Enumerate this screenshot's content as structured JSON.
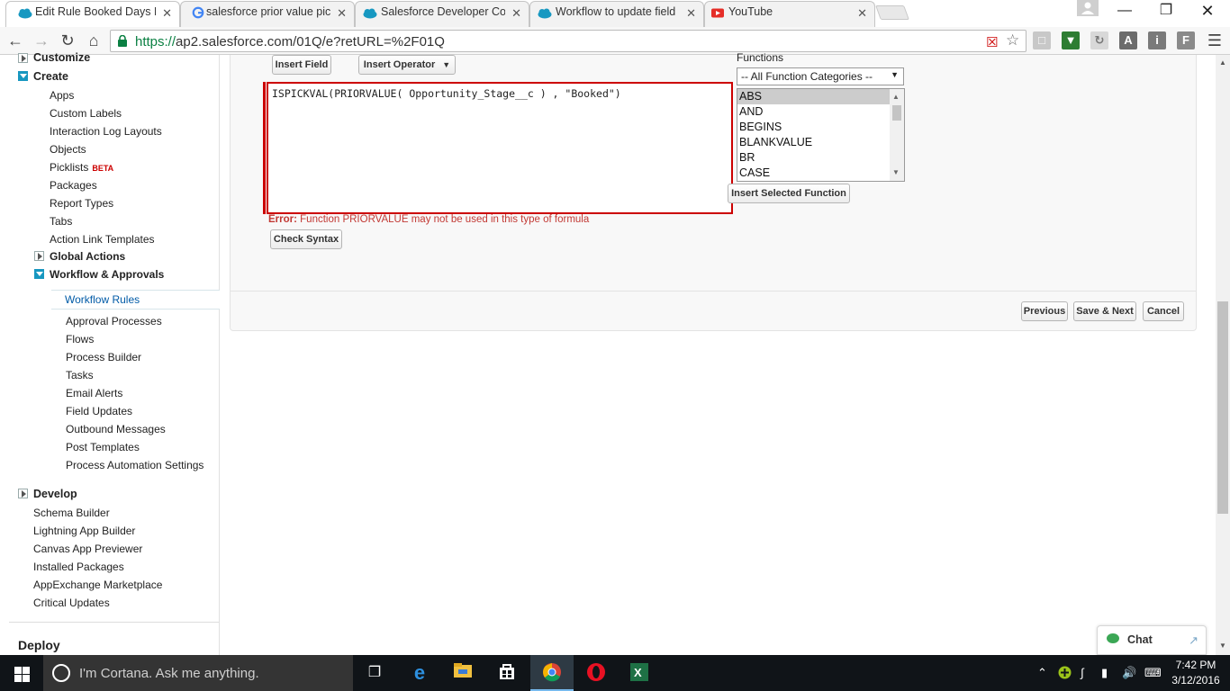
{
  "browser": {
    "tabs": [
      {
        "title": "Edit Rule Booked Days Ru",
        "favicon": "salesforce-cloud-icon",
        "active": true
      },
      {
        "title": "salesforce prior value pick",
        "favicon": "google-g-icon",
        "active": false
      },
      {
        "title": "Salesforce Developer Com",
        "favicon": "salesforce-cloud-icon",
        "active": false
      },
      {
        "title": "Workflow to update field",
        "favicon": "salesforce-cloud-icon",
        "active": false
      },
      {
        "title": "YouTube",
        "favicon": "youtube-icon",
        "active": false
      }
    ],
    "close_glyph": "✕",
    "url_scheme": "https://",
    "url_rest": "ap2.salesforce.com/01Q/e?retURL=%2F01Q"
  },
  "sidebar": {
    "customize": "Customize",
    "create": "Create",
    "create_items": [
      "Apps",
      "Custom Labels",
      "Interaction Log Layouts",
      "Objects",
      "Picklists",
      "Packages",
      "Report Types",
      "Tabs",
      "Action Link Templates"
    ],
    "beta": "BETA",
    "global_actions": "Global Actions",
    "workflow": "Workflow & Approvals",
    "workflow_selected": "Workflow Rules",
    "workflow_items": [
      "Approval Processes",
      "Flows",
      "Process Builder",
      "Tasks",
      "Email Alerts",
      "Field Updates",
      "Outbound Messages",
      "Post Templates",
      "Process Automation Settings"
    ],
    "develop": "Develop",
    "develop_items": [
      "Schema Builder",
      "Lightning App Builder",
      "Canvas App Previewer",
      "Installed Packages",
      "AppExchange Marketplace",
      "Critical Updates"
    ],
    "deploy": "Deploy"
  },
  "editor": {
    "insert_field": "Insert Field",
    "insert_operator": "Insert Operator",
    "formula": "ISPICKVAL(PRIORVALUE( Opportunity_Stage__c ) , \"Booked\")",
    "error_label": "Error:",
    "error_text": " Function PRIORVALUE may not be used in this type of formula",
    "check_syntax": "Check Syntax",
    "functions_label": "Functions",
    "function_category": "-- All Function Categories --",
    "functions": [
      "ABS",
      "AND",
      "BEGINS",
      "BLANKVALUE",
      "BR",
      "CASE"
    ],
    "selected_function": "ABS",
    "insert_function": "Insert Selected Function"
  },
  "footer": {
    "previous": "Previous",
    "save_next": "Save & Next",
    "cancel": "Cancel"
  },
  "chat": {
    "label": "Chat"
  },
  "taskbar": {
    "cortana": "I'm Cortana. Ask me anything.",
    "time": "7:42 PM",
    "date": "3/12/2016"
  },
  "colors": {
    "accent": "#1797c0",
    "error": "#c23934",
    "link": "#015ba7"
  }
}
